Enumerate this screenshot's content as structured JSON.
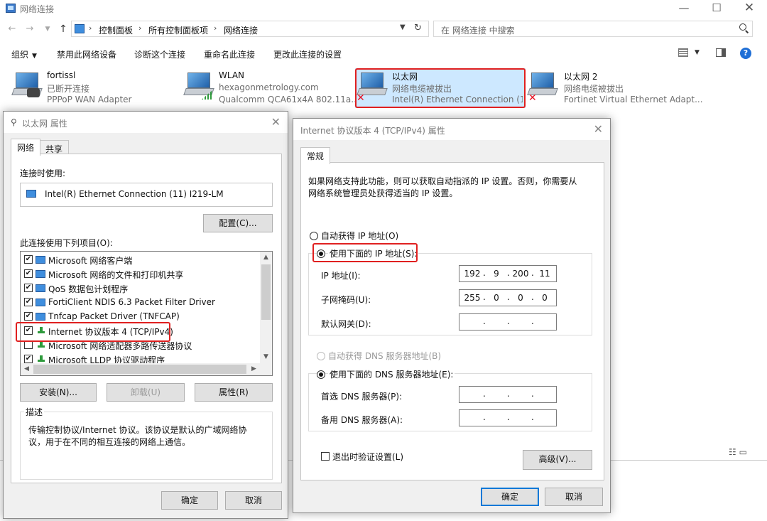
{
  "explorer": {
    "title": "网络连接",
    "breadcrumbs": [
      "控制面板",
      "所有控制面板项",
      "网络连接"
    ],
    "search_placeholder": "在 网络连接 中搜索",
    "commands": {
      "organize": "组织",
      "disable": "禁用此网络设备",
      "diagnose": "诊断这个连接",
      "rename": "重命名此连接",
      "change_settings": "更改此连接的设置"
    },
    "adapters": [
      {
        "name": "fortissl",
        "status": "已断开连接",
        "device": "PPPoP WAN Adapter"
      },
      {
        "name": "WLAN",
        "status": "hexagonmetrology.com",
        "device": "Qualcomm QCA61x4A 802.11a..."
      },
      {
        "name": "以太网",
        "status": "网络电缆被拔出",
        "device": "Intel(R) Ethernet Connection (1..."
      },
      {
        "name": "以太网 2",
        "status": "网络电缆被拔出",
        "device": "Fortinet Virtual Ethernet Adapt..."
      }
    ]
  },
  "eth_props": {
    "title": "以太网 属性",
    "tabs": [
      "网络",
      "共享"
    ],
    "connect_using_label": "连接时使用:",
    "adapter_name": "Intel(R) Ethernet Connection (11) I219-LM",
    "configure_button": "配置(C)...",
    "items_label": "此连接使用下列项目(O):",
    "items": [
      {
        "label": "Microsoft 网络客户端",
        "checked": "✔"
      },
      {
        "label": "Microsoft 网络的文件和打印机共享",
        "checked": "✔"
      },
      {
        "label": "QoS 数据包计划程序",
        "checked": "✔"
      },
      {
        "label": "FortiClient NDIS 6.3 Packet Filter Driver",
        "checked": "✔"
      },
      {
        "label": "Tnfcap Packet Driver (TNFCAP)",
        "checked": "✔"
      },
      {
        "label": "Internet 协议版本 4 (TCP/IPv4)",
        "checked": "✔"
      },
      {
        "label": "Microsoft 网络适配器多路传送器协议",
        "checked": ""
      },
      {
        "label": "Microsoft LLDP 协议驱动程序",
        "checked": "✔"
      }
    ],
    "install_button": "安装(N)...",
    "uninstall_button": "卸载(U)",
    "properties_button": "属性(R)",
    "description_title": "描述",
    "description": "传输控制协议/Internet 协议。该协议是默认的广域网络协议，用于在不同的相互连接的网络上通信。",
    "ok_button": "确定",
    "cancel_button": "取消"
  },
  "ipv4_props": {
    "title": "Internet 协议版本 4 (TCP/IPv4) 属性",
    "tab": "常规",
    "intro": "如果网络支持此功能，则可以获取自动指派的 IP 设置。否则，你需要从网络系统管理员处获得适当的 IP 设置。",
    "auto_ip": "自动获得 IP 地址(O)",
    "manual_ip": "使用下面的 IP 地址(S):",
    "ip_label": "IP 地址(I):",
    "ip_address": [
      "192",
      "9",
      "200",
      "11"
    ],
    "mask_label": "子网掩码(U):",
    "subnet_mask": [
      "255",
      "0",
      "0",
      "0"
    ],
    "gateway_label": "默认网关(D):",
    "auto_dns": "自动获得 DNS 服务器地址(B)",
    "manual_dns": "使用下面的 DNS 服务器地址(E):",
    "preferred_dns_label": "首选 DNS 服务器(P):",
    "alternate_dns_label": "备用 DNS 服务器(A):",
    "validate_label": "退出时验证设置(L)",
    "advanced_button": "高级(V)...",
    "ok_button": "确定",
    "cancel_button": "取消"
  },
  "colors": {
    "highlight_red": "#e02020",
    "selection_blue": "#cde8ff",
    "accent": "#0078d7"
  }
}
